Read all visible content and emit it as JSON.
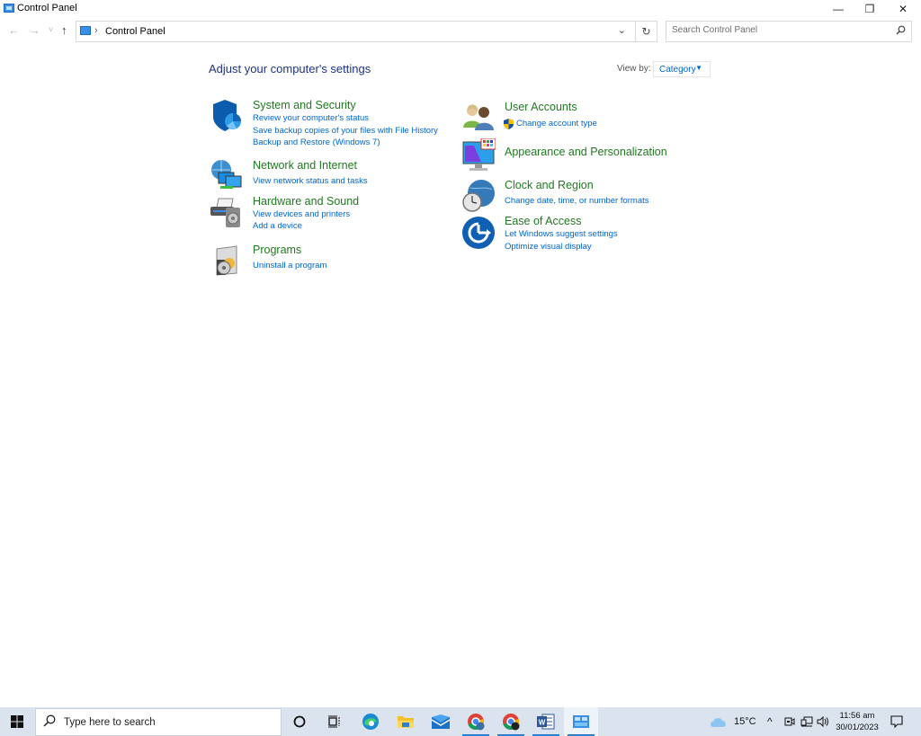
{
  "window": {
    "title": "Control Panel",
    "controls": {
      "minimize": "—",
      "restore": "❐",
      "close": "✕"
    }
  },
  "nav": {
    "back_icon": "←",
    "forward_icon": "→",
    "recent_icon": "˅",
    "up_icon": "↑"
  },
  "address": {
    "separator": "›",
    "crumb": "Control Panel",
    "dropdown_icon": "⌄",
    "refresh_icon": "↻"
  },
  "search": {
    "placeholder": "Search Control Panel",
    "icon": "⚲"
  },
  "main": {
    "heading": "Adjust your computer's settings",
    "view_by_label": "View by:",
    "view_by_value": "Category",
    "view_by_caret": "▼",
    "left_categories": [
      {
        "title": "System and Security",
        "links": [
          "Review your computer's status",
          "Save backup copies of your files with File History",
          "Backup and Restore (Windows 7)"
        ]
      },
      {
        "title": "Network and Internet",
        "links": [
          "View network status and tasks"
        ]
      },
      {
        "title": "Hardware and Sound",
        "links": [
          "View devices and printers",
          "Add a device"
        ]
      },
      {
        "title": "Programs",
        "links": [
          "Uninstall a program"
        ]
      }
    ],
    "right_categories": [
      {
        "title": "User Accounts",
        "links": [
          "Change account type"
        ]
      },
      {
        "title": "Appearance and Personalization",
        "links": []
      },
      {
        "title": "Clock and Region",
        "links": [
          "Change date, time, or number formats"
        ]
      },
      {
        "title": "Ease of Access",
        "links": [
          "Let Windows suggest settings",
          "Optimize visual display"
        ]
      }
    ]
  },
  "taskbar": {
    "search_placeholder": "Type here to search",
    "apps": [
      "Cortana",
      "Task View",
      "Microsoft Edge",
      "File Explorer",
      "Mail",
      "Google Chrome",
      "Google Chrome (profile)",
      "Microsoft Word",
      "Control Panel"
    ],
    "weather": "15°C",
    "tray_chevron": "^",
    "time": "11:56 am",
    "date": "30/01/2023"
  },
  "colors": {
    "category_title": "#1f7a1f",
    "link": "#0066cc",
    "heading": "#1e3287",
    "taskbar": "#dae3ee"
  }
}
